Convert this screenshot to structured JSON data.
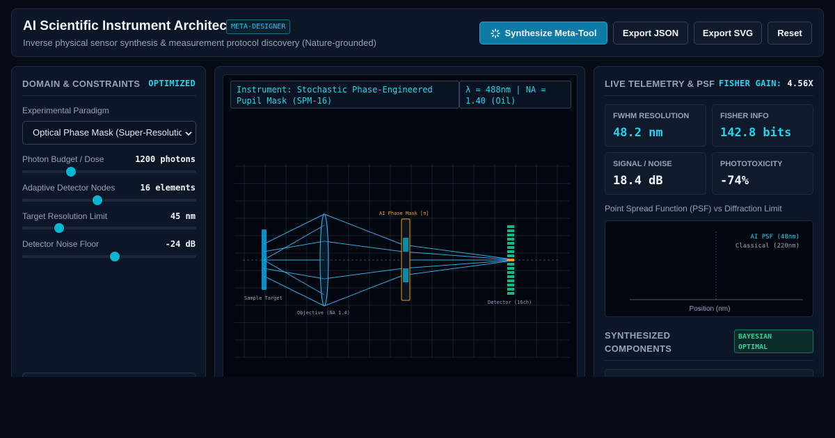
{
  "header": {
    "title": "AI Scientific Instrument Architect",
    "badge": "META-DESIGNER",
    "subtitle": "Inverse physical sensor synthesis & measurement protocol discovery (Nature-grounded)",
    "buttons": {
      "synthesize": "Synthesize Meta-Tool",
      "export_json": "Export JSON",
      "export_svg": "Export SVG",
      "reset": "Reset"
    }
  },
  "left": {
    "title": "DOMAIN & CONSTRAINTS",
    "status": "OPTIMIZED",
    "paradigm_label": "Experimental Paradigm",
    "paradigm_value": "Optical Phase Mask (Super-Resolution)",
    "sliders": [
      {
        "label": "Photon Budget / Dose",
        "value": "1200 photons",
        "level": 0.28
      },
      {
        "label": "Adaptive Detector Nodes",
        "value": "16 elements",
        "level": 0.43
      },
      {
        "label": "Target Resolution Limit",
        "value": "45 nm",
        "level": 0.21
      },
      {
        "label": "Detector Noise Floor",
        "value": "-24 dB",
        "level": 0.53
      }
    ]
  },
  "center": {
    "instrument_label": "Instrument: Stochastic Phase-Engineered Pupil Mask (SPM-16)",
    "optics_label": "λ = 488nm | NA = 1.40 (Oil)",
    "diagram": {
      "sample": "Sample Target",
      "objective": "Objective (NA 1.4)",
      "mask": "AI Phase Mask [π]",
      "detector": "Detector (16ch)"
    }
  },
  "right": {
    "title": "LIVE TELEMETRY & PSF",
    "fisher_gain_label": "FISHER GAIN:",
    "fisher_gain_value": "4.56X",
    "metrics": [
      {
        "label": "FWHM RESOLUTION",
        "value": "48.2 nm",
        "color": "#22d3ee"
      },
      {
        "label": "FISHER INFO",
        "value": "142.8 bits",
        "color": "#22d3ee"
      },
      {
        "label": "SIGNAL / NOISE",
        "value": "18.4 dB",
        "color": "#f1f5f9"
      },
      {
        "label": "PHOTOTOXICITY",
        "value": "-74%",
        "color": "#f1f5f9"
      }
    ],
    "psf_title": "Point Spread Function (PSF) vs Diffraction Limit",
    "psf_legend_ai": "AI PSF (48nm)",
    "psf_legend_classical": "Classical (220nm)",
    "psf_xlabel": "Position (nm)",
    "components_title_1": "SYNTHESIZED",
    "components_title_2": "COMPONENTS",
    "components_badge_1": "BAYESIAN",
    "components_badge_2": "OPTIMAL"
  },
  "colors": {
    "accent": "#06b6d4",
    "brand_button": "#0e7aa6",
    "success": "#34d399",
    "mask": "#f59e0b"
  }
}
